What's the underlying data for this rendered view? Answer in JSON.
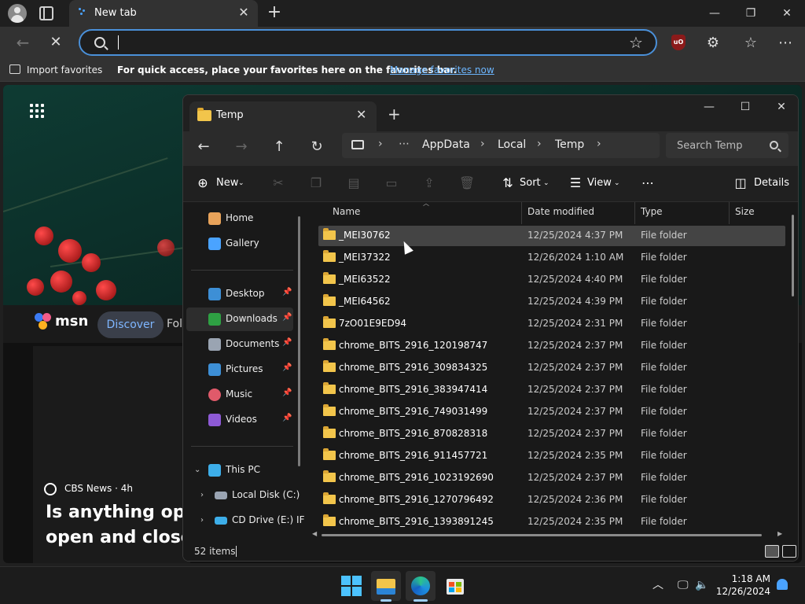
{
  "browser": {
    "tab_title": "New tab",
    "address_value": "",
    "favorites": {
      "import_label": "Import favorites",
      "message": "For quick access, place your favorites here on the favorites bar.",
      "manage_link": "Manage favorites now"
    },
    "icons": [
      "profile-icon",
      "tab-actions-icon",
      "close-icon",
      "plus-icon",
      "back-icon",
      "stop-icon",
      "search-icon",
      "star-icon",
      "ublock-icon",
      "extensions-icon",
      "favorites-icon",
      "more-icon"
    ]
  },
  "ntp": {
    "brand": "msn",
    "nav_selected": "Discover",
    "nav_next": "Fol",
    "news": {
      "source": "CBS News · 4h",
      "headline_line1": "Is anything oper",
      "headline_line2": "open and closed"
    }
  },
  "explorer": {
    "tab_title": "Temp",
    "breadcrumb": [
      "AppData",
      "Local",
      "Temp"
    ],
    "search_placeholder": "Search Temp",
    "commands": {
      "new": "New",
      "sort": "Sort",
      "view": "View",
      "details": "Details"
    },
    "sidebar": [
      {
        "label": "Home",
        "icon": "home-icon",
        "color": "#e8a35a"
      },
      {
        "label": "Gallery",
        "icon": "gallery-icon",
        "color": "#4aa3ff"
      },
      {
        "label": "Desktop",
        "icon": "desktop-icon",
        "color": "#3d8fd6",
        "pinned": true
      },
      {
        "label": "Downloads",
        "icon": "downloads-icon",
        "color": "#2ea043",
        "pinned": true,
        "selected": true
      },
      {
        "label": "Documents",
        "icon": "documents-icon",
        "color": "#9aa4b2",
        "pinned": true
      },
      {
        "label": "Pictures",
        "icon": "pictures-icon",
        "color": "#3d8fd6",
        "pinned": true
      },
      {
        "label": "Music",
        "icon": "music-icon",
        "color": "#e05a6a",
        "pinned": true
      },
      {
        "label": "Videos",
        "icon": "videos-icon",
        "color": "#8e5ad6",
        "pinned": true
      },
      {
        "label": "This PC",
        "icon": "this-pc-icon",
        "color": "#3daee9"
      },
      {
        "label": "Local Disk (C:)",
        "icon": "disk-icon",
        "color": "#9aa4b2"
      },
      {
        "label": "CD Drive (E:) IF",
        "icon": "cd-drive-icon",
        "color": "#3daee9"
      }
    ],
    "columns": [
      "Name",
      "Date modified",
      "Type",
      "Size"
    ],
    "files": [
      {
        "name": "_MEI30762",
        "date": "12/25/2024 4:37 PM",
        "type": "File folder"
      },
      {
        "name": "_MEI37322",
        "date": "12/26/2024 1:10 AM",
        "type": "File folder"
      },
      {
        "name": "_MEI63522",
        "date": "12/25/2024 4:40 PM",
        "type": "File folder"
      },
      {
        "name": "_MEI64562",
        "date": "12/25/2024 4:39 PM",
        "type": "File folder"
      },
      {
        "name": "7zO01E9ED94",
        "date": "12/25/2024 2:31 PM",
        "type": "File folder"
      },
      {
        "name": "chrome_BITS_2916_120198747",
        "date": "12/25/2024 2:37 PM",
        "type": "File folder"
      },
      {
        "name": "chrome_BITS_2916_309834325",
        "date": "12/25/2024 2:37 PM",
        "type": "File folder"
      },
      {
        "name": "chrome_BITS_2916_383947414",
        "date": "12/25/2024 2:37 PM",
        "type": "File folder"
      },
      {
        "name": "chrome_BITS_2916_749031499",
        "date": "12/25/2024 2:37 PM",
        "type": "File folder"
      },
      {
        "name": "chrome_BITS_2916_870828318",
        "date": "12/25/2024 2:37 PM",
        "type": "File folder"
      },
      {
        "name": "chrome_BITS_2916_911457721",
        "date": "12/25/2024 2:35 PM",
        "type": "File folder"
      },
      {
        "name": "chrome_BITS_2916_1023192690",
        "date": "12/25/2024 2:37 PM",
        "type": "File folder"
      },
      {
        "name": "chrome_BITS_2916_1270796492",
        "date": "12/25/2024 2:36 PM",
        "type": "File folder"
      },
      {
        "name": "chrome_BITS_2916_1393891245",
        "date": "12/25/2024 2:35 PM",
        "type": "File folder"
      }
    ],
    "status": "52 items"
  },
  "taskbar": {
    "time": "1:18 AM",
    "date": "12/26/2024",
    "apps": [
      "windows-start-icon",
      "file-explorer-icon",
      "edge-icon",
      "store-icon"
    ]
  }
}
